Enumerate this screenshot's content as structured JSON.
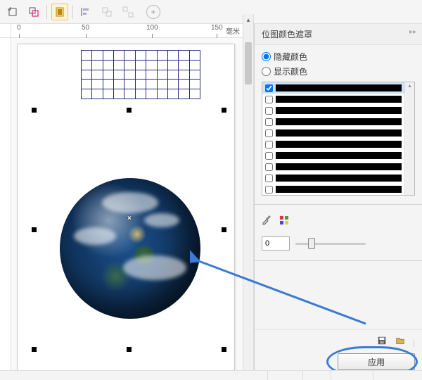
{
  "toolbar": {
    "icons": [
      "crop-icon",
      "transform-icon",
      "trace-icon",
      "align-left-icon",
      "group-icon",
      "ungroup-icon",
      "add-icon"
    ]
  },
  "ruler": {
    "ticks": [
      "0",
      "50",
      "100",
      "150"
    ],
    "unit": "毫米"
  },
  "panel": {
    "title": "位图颜色遮罩",
    "hide_label": "隐藏颜色",
    "show_label": "显示颜色",
    "mode": "hide",
    "colors": [
      {
        "checked": true,
        "hex": "#000000"
      },
      {
        "checked": false,
        "hex": "#000000"
      },
      {
        "checked": false,
        "hex": "#000000"
      },
      {
        "checked": false,
        "hex": "#000000"
      },
      {
        "checked": false,
        "hex": "#000000"
      },
      {
        "checked": false,
        "hex": "#000000"
      },
      {
        "checked": false,
        "hex": "#000000"
      },
      {
        "checked": false,
        "hex": "#000000"
      },
      {
        "checked": false,
        "hex": "#000000"
      },
      {
        "checked": false,
        "hex": "#000000"
      }
    ],
    "tolerance_value": "0",
    "apply_label": "应用"
  },
  "canvas": {
    "grid_rows": 5,
    "grid_cols": 11
  }
}
